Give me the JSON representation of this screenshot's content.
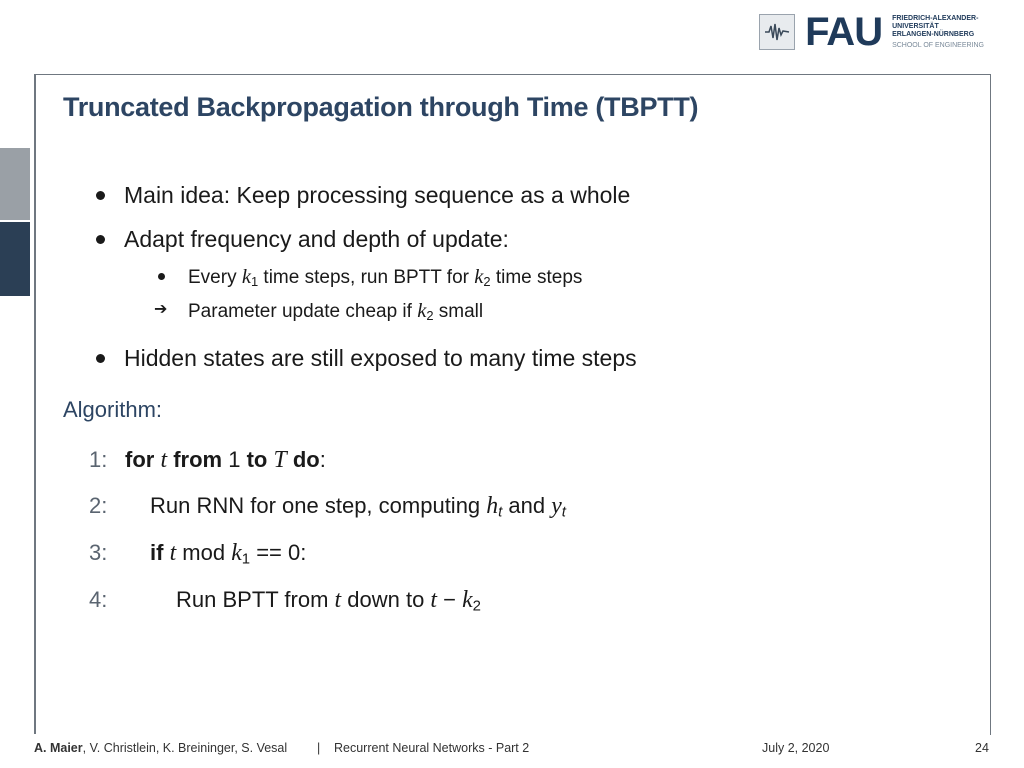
{
  "header": {
    "logo_wordmark": "FAU",
    "logo_line1": "FRIEDRICH-ALEXANDER-",
    "logo_line2": "UNIVERSITÄT",
    "logo_line3": "ERLANGEN-NÜRNBERG",
    "logo_line4": "SCHOOL OF ENGINEERING",
    "lecture_icon": "waveform-icon"
  },
  "slide": {
    "title": "Truncated Backpropagation through Time (TBPTT)",
    "bullet1": "Main idea: Keep processing sequence as a whole",
    "bullet2": "Adapt frequency and depth of update:",
    "sub1_a": "Every ",
    "sub1_k": "k",
    "sub1_i1": "1",
    "sub1_b": " time steps, run BPTT for ",
    "sub1_k2": "k",
    "sub1_i2": "2",
    "sub1_c": " time steps",
    "sub2_a": "Parameter update cheap if ",
    "sub2_k": "k",
    "sub2_i": "2",
    "sub2_b": " small",
    "bullet3": "Hidden states are still exposed to many time steps",
    "algorithm_label": "Algorithm:",
    "algo": {
      "n1": "1:",
      "l1_for": "for",
      "l1_t": "t",
      "l1_from": "from",
      "l1_1": "1",
      "l1_to": "to",
      "l1_T": "T",
      "l1_do": "do",
      "l1_colon": ":",
      "n2": "2:",
      "l2_a": "Run RNN for one step, computing ",
      "l2_h": "h",
      "l2_hi": "t",
      "l2_and": " and ",
      "l2_y": "y",
      "l2_yi": "t",
      "n3": "3:",
      "l3_if": "if",
      "l3_t": "t",
      "l3_mod": " mod ",
      "l3_k": "k",
      "l3_ki": "1",
      "l3_eq": " == 0:",
      "n4": "4:",
      "l4_a": "Run BPTT from ",
      "l4_t": "t",
      "l4_b": " down to ",
      "l4_t2": "t",
      "l4_minus": " − ",
      "l4_k": "k",
      "l4_ki": "2"
    }
  },
  "footer": {
    "author_bold": "A. Maier",
    "authors_rest": ", V. Christlein, K. Breininger, S. Vesal",
    "separator": "|",
    "course": "Recurrent Neural Networks - Part 2",
    "date": "July 2, 2020",
    "page": "24"
  }
}
